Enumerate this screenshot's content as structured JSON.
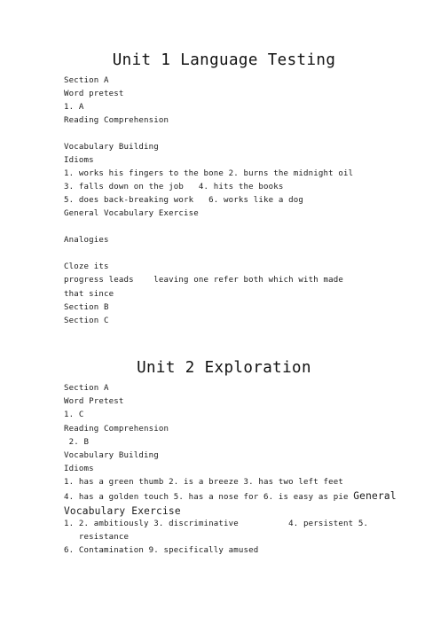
{
  "document": {
    "page_background": "#ffffff",
    "text_color": "#1b1b1b",
    "units": [
      {
        "title": "Unit 1 Language Testing",
        "lines": [
          "Section A",
          "Word pretest",
          "1. A",
          "Reading Comprehension",
          "",
          "Vocabulary Building",
          "Idioms",
          "1. works his fingers to the bone 2. burns the midnight oil",
          "3. falls down on the job   4. hits the books",
          "5. does back-breaking work   6. works like a dog",
          "General Vocabulary Exercise",
          "",
          "Analogies",
          "",
          "Cloze its",
          "progress leads    leaving one refer both which with made",
          "that since",
          "Section B",
          "Section C"
        ]
      },
      {
        "title": "Unit 2 Exploration",
        "lines": [
          "Section A",
          "Word Pretest",
          "1. C",
          "Reading Comprehension",
          " 2. B",
          "Vocabulary Building",
          "Idioms",
          "1. has a green thumb 2. is a breeze 3. has two left feet",
          "4. has a golden touch 5. has a nose for 6. is easy as pie General",
          "Vocabulary Exercise",
          "1. 2. ambitiously 3. discriminative          4. persistent 5.",
          "   resistance",
          "6. Contamination 9. specifically amused"
        ],
        "line_styles": [
          "normal",
          "normal",
          "normal",
          "normal",
          "normal",
          "normal",
          "normal",
          "normal",
          "mixed-tail-big",
          "big",
          "spread",
          "normal",
          "normal"
        ],
        "mixed_line": {
          "small_part": "4. has a golden touch 5. has a nose for 6. is easy as pie ",
          "big_part": "General"
        },
        "spread_line": {
          "left": "1. 2. ambitiously 3. discriminative",
          "right": "4. persistent 5."
        }
      }
    ]
  }
}
